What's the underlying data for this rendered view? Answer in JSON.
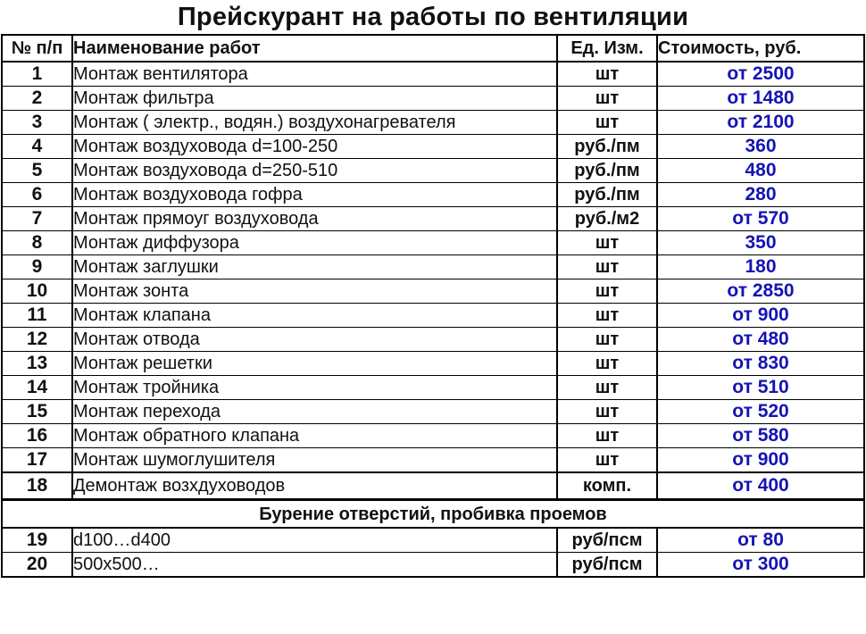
{
  "title": "Прейскурант на работы по вентиляции",
  "table": {
    "headers": {
      "num": "№ п/п",
      "name": "Наименование работ",
      "unit": "Ед. Изм.",
      "price": "Стоимость, руб."
    },
    "rows": [
      {
        "num": "1",
        "name": "Монтаж вентилятора",
        "unit": "шт",
        "price": "от 2500"
      },
      {
        "num": "2",
        "name": "Монтаж фильтра",
        "unit": "шт",
        "price": "от 1480"
      },
      {
        "num": "3",
        "name": "Монтаж ( электр., водян.) воздухонагревателя",
        "unit": "шт",
        "price": "от 2100"
      },
      {
        "num": "4",
        "name": "Монтаж воздуховода  d=100-250",
        "unit": "руб./пм",
        "price": "360"
      },
      {
        "num": "5",
        "name": "Монтаж воздуховода  d=250-510",
        "unit": "руб./пм",
        "price": "480"
      },
      {
        "num": "6",
        "name": "Монтаж воздуховода  гофра",
        "unit": "руб./пм",
        "price": "280"
      },
      {
        "num": "7",
        "name": "Монтаж прямоуг воздуховода",
        "unit": "руб./м2",
        "price": "от 570"
      },
      {
        "num": "8",
        "name": "Монтаж диффузора",
        "unit": "шт",
        "price": "350"
      },
      {
        "num": "9",
        "name": "Монтаж заглушки",
        "unit": "шт",
        "price": "180"
      },
      {
        "num": "10",
        "name": "Монтаж зонта",
        "unit": "шт",
        "price": "от 2850"
      },
      {
        "num": "11",
        "name": "Монтаж клапана",
        "unit": "шт",
        "price": "от 900"
      },
      {
        "num": "12",
        "name": "Монтаж отвода",
        "unit": "шт",
        "price": "от 480"
      },
      {
        "num": "13",
        "name": "Монтаж решетки",
        "unit": "шт",
        "price": "от 830"
      },
      {
        "num": "14",
        "name": "Монтаж тройника",
        "unit": "шт",
        "price": "от 510"
      },
      {
        "num": "15",
        "name": "Монтаж перехода",
        "unit": "шт",
        "price": "от 520"
      },
      {
        "num": "16",
        "name": "Монтаж обратного клапана",
        "unit": "шт",
        "price": "от 580"
      },
      {
        "num": "17",
        "name": "Монтаж шумоглушителя",
        "unit": "шт",
        "price": "от 900"
      },
      {
        "num": "18",
        "name": "Демонтаж возхдуховодов",
        "unit": "комп.",
        "price": "от 400"
      }
    ],
    "section": {
      "title": "Бурение отверстий, пробивка проемов",
      "rows": [
        {
          "num": "19",
          "name": "d100…d400",
          "unit": "руб/псм",
          "price": "от 80"
        },
        {
          "num": "20",
          "name": "500x500…",
          "unit": "руб/псм",
          "price": "от 300"
        }
      ]
    }
  },
  "colors": {
    "price_text": "#1414b4",
    "text": "#111111",
    "border": "#000000"
  }
}
